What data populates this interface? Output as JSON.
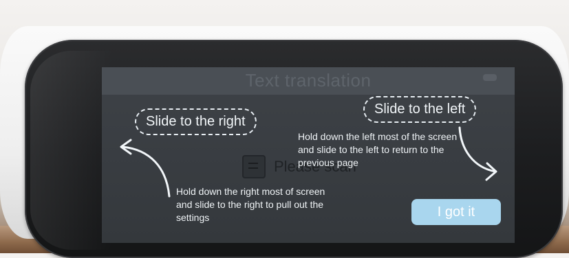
{
  "header": {
    "title": "Text translation"
  },
  "background": {
    "prompt_text": "Please scan"
  },
  "guide": {
    "right": {
      "label": "Slide to the right",
      "description": "Hold down the right most of screen and slide to the right to pull out the settings"
    },
    "left": {
      "label": "Slide to the left",
      "description": "Hold down the left most of the screen and slide to the left to return to the previous page"
    },
    "confirm_label": "I got it"
  },
  "colors": {
    "screen_bg": "#3a3e43",
    "button_bg": "#a9d6ee",
    "overlay_text": "#f0f4f7"
  },
  "icons": {
    "left_arrow": "curved-arrow-left-icon",
    "right_arrow": "curved-arrow-right-icon",
    "document": "document-icon"
  }
}
